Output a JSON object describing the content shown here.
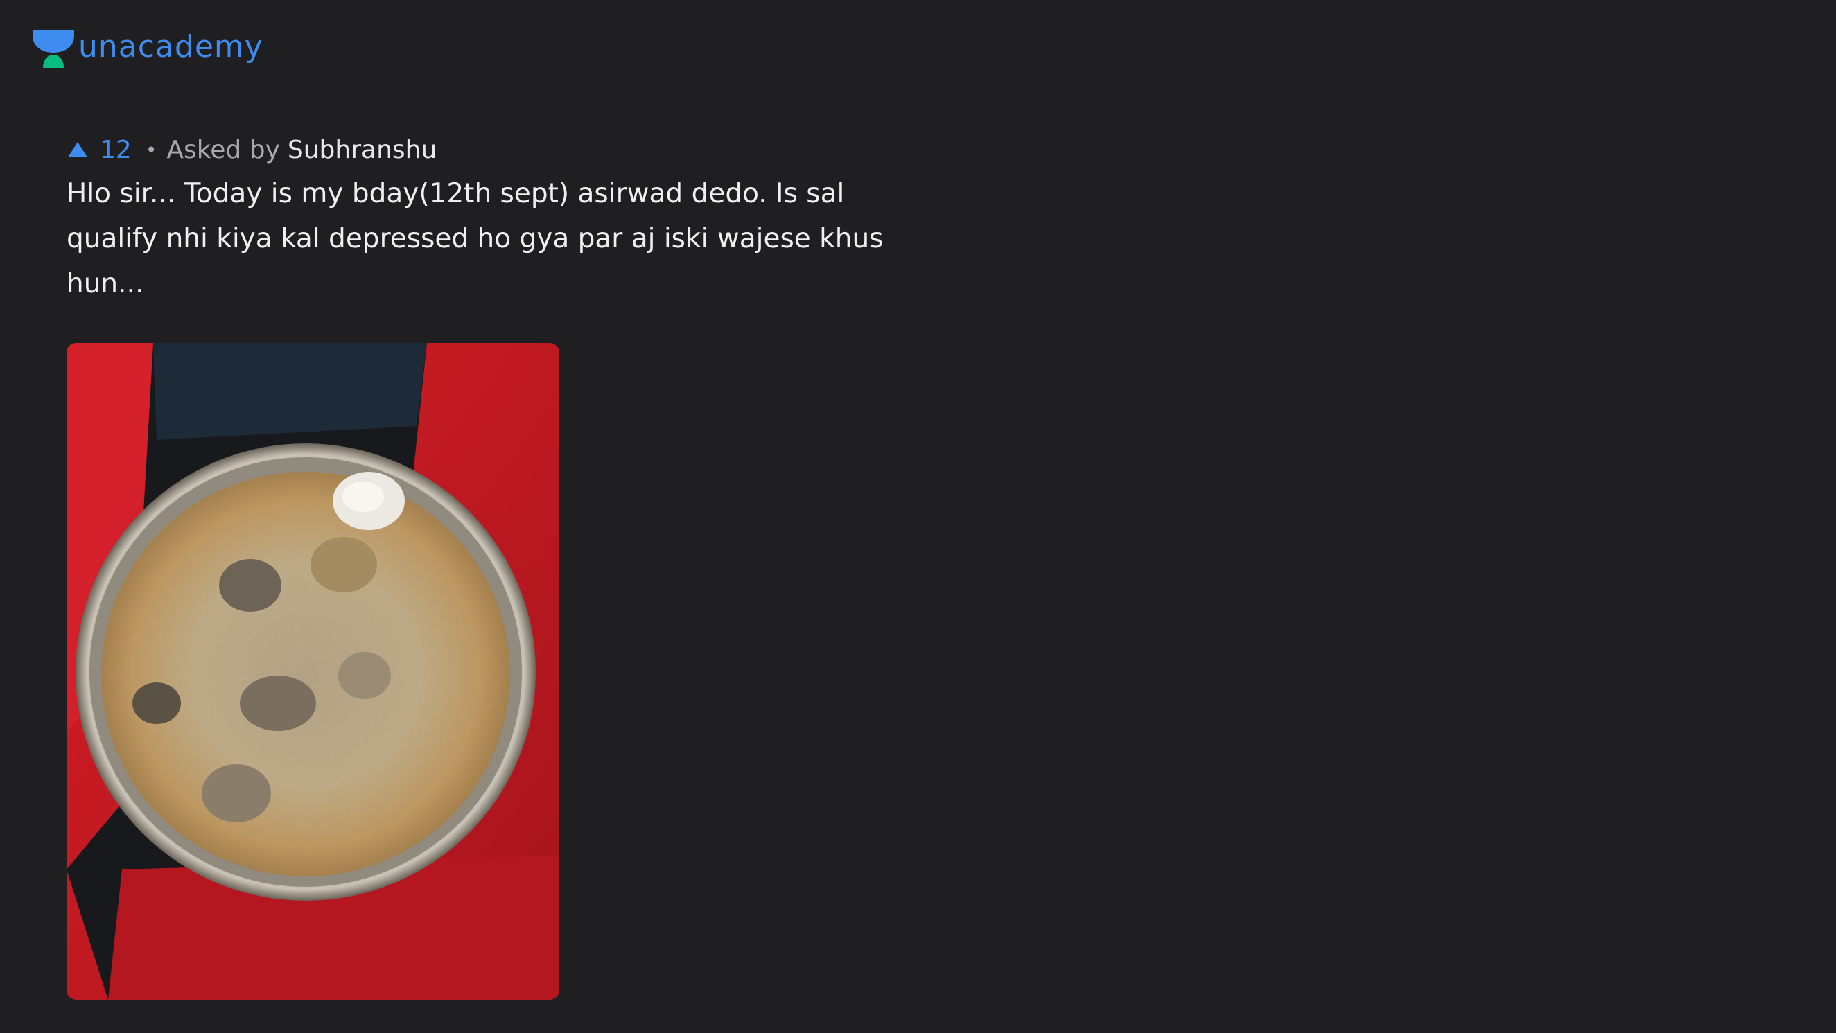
{
  "brand": {
    "name": "unacademy"
  },
  "question": {
    "upvotes": "12",
    "separator": "•",
    "asked_by_label": "Asked by",
    "author": "Subhranshu",
    "text": "Hlo sir... Today is my bday(12th sept) asirwad dedo. Is sal qualify nhi kiya kal depressed ho gya par aj iski wajese khus hun..."
  },
  "icons": {
    "upvote": "upvote-triangle-icon",
    "logo": "unacademy-logo-icon"
  },
  "colors": {
    "background": "#1f1f22",
    "accent": "#3f8cf0",
    "logo_green": "#08bd80",
    "text_primary": "#f0f0f2",
    "text_secondary": "#a8a8ae"
  }
}
